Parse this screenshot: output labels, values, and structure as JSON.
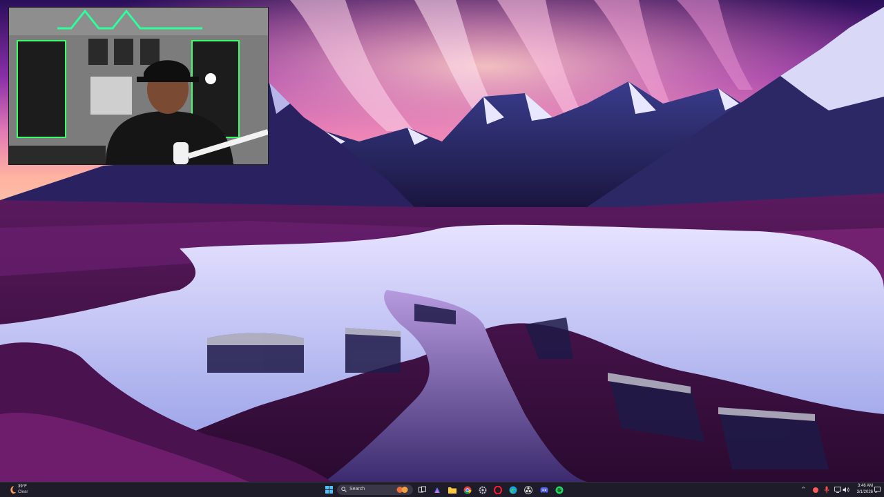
{
  "weather": {
    "temperature": "39°F",
    "condition": "Clear",
    "icon": "weather-moon-icon"
  },
  "taskbar": {
    "start_icon": "windows-start-icon",
    "search_placeholder": "Search",
    "pinned_apps": [
      "task-view-icon",
      "file-explorer-icon",
      "copilot-icon",
      "folder-icon",
      "chrome-icon",
      "settings-icon",
      "opera-icon",
      "edge-icon",
      "obs-icon",
      "discord-icon",
      "spotify-icon"
    ],
    "accent_color": "#0078d4"
  },
  "system_tray": {
    "icons": [
      "chevron-up-icon",
      "app-tray-icon",
      "microphone-icon",
      "display-icon",
      "volume-icon",
      "notification-icon"
    ]
  },
  "clock": {
    "time": "3:46 AM",
    "date": "3/1/2026"
  }
}
